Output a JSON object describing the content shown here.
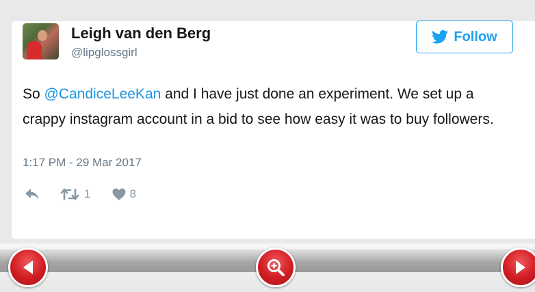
{
  "tweet": {
    "author_name": "Leigh van den Berg",
    "author_handle": "@lipglossgirl",
    "follow_label": "Follow",
    "text_part1": "So ",
    "mention": "@CandiceLeeKan",
    "text_part2": " and I have just done an experiment. We set up a crappy instagram account in a bid to see how easy it was to buy followers.",
    "timestamp": "1:17 PM - 29 Mar 2017",
    "retweet_count": "1",
    "like_count": "8"
  },
  "colors": {
    "twitter_blue": "#1da1f2",
    "mention_blue": "#1b95e0",
    "nav_red": "#d01d22"
  },
  "icons": {
    "reply": "reply-icon",
    "retweet": "retweet-icon",
    "like": "heart-icon",
    "follow_bird": "twitter-bird-icon",
    "prev": "arrow-left-icon",
    "zoom": "zoom-icon",
    "next": "arrow-right-icon"
  }
}
